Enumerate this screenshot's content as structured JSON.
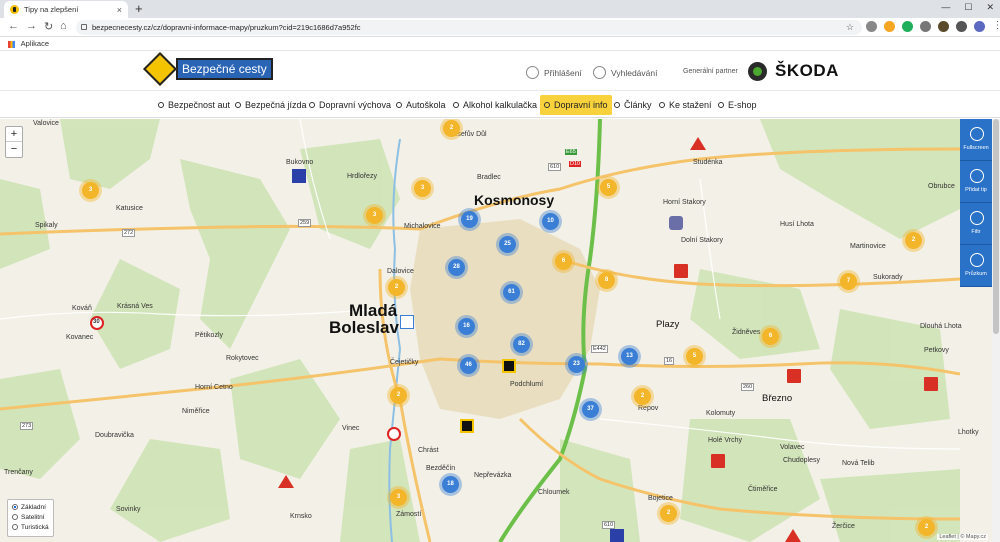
{
  "browser": {
    "tab_title": "Tipy na zlepšení",
    "url": "bezpecnecesty.cz/cz/dopravni-informace-mapy/pruzkum?cid=219c1686d7a952fc",
    "bookmarks_label": "Aplikace"
  },
  "header": {
    "logo_text": "Bezpečné cesty",
    "login_label": "Přihlášení",
    "search_label": "Vyhledávání",
    "partner_label": "Generální partner",
    "partner_name": "ŠKODA"
  },
  "menu": {
    "items": [
      {
        "label": "Bezpečnost aut"
      },
      {
        "label": "Bezpečná jízda"
      },
      {
        "label": "Dopravní výchova"
      },
      {
        "label": "Autoškola"
      },
      {
        "label": "Alkohol kalkulačka"
      },
      {
        "label": "Dopravní info",
        "active": true
      },
      {
        "label": "Články"
      },
      {
        "label": "Ke stažení"
      },
      {
        "label": "E-shop"
      }
    ]
  },
  "map": {
    "zoom_in": "+",
    "zoom_out": "−",
    "layers": [
      "Základní",
      "Satelitní",
      "Turistická"
    ],
    "selected_layer": "Základní",
    "side_tools": [
      "Fullscreen",
      "Přidat tip",
      "Filtr",
      "Průzkum"
    ],
    "attribution": "Leaflet | © Mapy.cz",
    "city_labels": [
      {
        "text": "Kosmonosy"
      },
      {
        "text": "Mladá"
      },
      {
        "text": "Boleslav"
      }
    ],
    "place_labels": [
      "Bukovno",
      "Hrdlořezy",
      "Katusice",
      "Josefův Důl",
      "Bradlec",
      "Studénka",
      "Obrubce",
      "Husí Lhota",
      "Martinovice",
      "Sukorady",
      "Dolní Stakory",
      "Horní Stakory",
      "Plazy",
      "Židněves",
      "Dlouhá Lhota",
      "Petkovy",
      "Březno",
      "Lhotky",
      "Dalovice",
      "Michalovice",
      "Krásná Ves",
      "Kováň",
      "Kovanec",
      "Pětikozly",
      "Rokytovec",
      "Horní Cetno",
      "Niměřice",
      "Doubravička",
      "Vinec",
      "Chrást",
      "Repov",
      "Kolomuty",
      "Nepřevázka",
      "Chloumek",
      "Krnsko",
      "Sovinky",
      "Zámostí",
      "Čejetičky",
      "Podchlumí",
      "Bezděčín",
      "Volavec",
      "Chudoplesy",
      "Holé Vrchy",
      "Nová Telib",
      "Čtiměřice",
      "Bojetice",
      "Žerčice",
      "Valovice",
      "Spikaly",
      "Trenčany"
    ],
    "clusters": [
      {
        "count": "2",
        "color": "orange"
      },
      {
        "count": "3",
        "color": "orange"
      },
      {
        "count": "3",
        "color": "orange"
      },
      {
        "count": "3",
        "color": "orange"
      },
      {
        "count": "19",
        "color": "blue"
      },
      {
        "count": "10",
        "color": "blue"
      },
      {
        "count": "5",
        "color": "orange"
      },
      {
        "count": "25",
        "color": "blue"
      },
      {
        "count": "28",
        "color": "blue"
      },
      {
        "count": "6",
        "color": "orange"
      },
      {
        "count": "8",
        "color": "orange"
      },
      {
        "count": "2",
        "color": "orange"
      },
      {
        "count": "61",
        "color": "blue"
      },
      {
        "count": "16",
        "color": "blue"
      },
      {
        "count": "82",
        "color": "blue"
      },
      {
        "count": "46",
        "color": "blue"
      },
      {
        "count": "23",
        "color": "blue"
      },
      {
        "count": "13",
        "color": "blue"
      },
      {
        "count": "5",
        "color": "orange"
      },
      {
        "count": "6",
        "color": "orange"
      },
      {
        "count": "7",
        "color": "orange"
      },
      {
        "count": "2",
        "color": "orange"
      },
      {
        "count": "2",
        "color": "orange"
      },
      {
        "count": "37",
        "color": "blue"
      },
      {
        "count": "2",
        "color": "orange"
      },
      {
        "count": "18",
        "color": "blue"
      },
      {
        "count": "3",
        "color": "orange"
      },
      {
        "count": "2",
        "color": "orange"
      },
      {
        "count": "2",
        "color": "orange"
      }
    ],
    "road_labels": [
      "272",
      "259",
      "610",
      "E65",
      "D10",
      "E442",
      "16",
      "260",
      "273",
      "610"
    ],
    "speed_sign": "30",
    "colors": {
      "cluster_orange": "#f3b52a",
      "cluster_blue": "#3a7fd5",
      "warning_red": "#d93025",
      "panel_blue": "#2a72c8",
      "menu_active": "#f8d23c"
    }
  }
}
